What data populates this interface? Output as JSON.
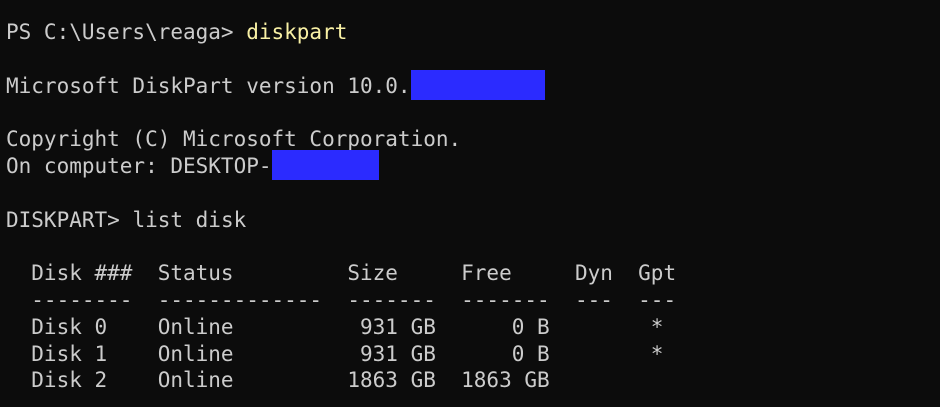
{
  "terminal": {
    "prompt": "PS C:\\Users\\reaga> ",
    "command": "diskpart",
    "version_line": "Microsoft DiskPart version 10.0.",
    "copyright_line": "Copyright (C) Microsoft Corporation.",
    "computer_line": "On computer: DESKTOP-",
    "diskpart_prompt": "DISKPART> ",
    "diskpart_command": "list disk"
  },
  "redaction_color": "#2b2bff",
  "table": {
    "header": "  Disk ###  Status         Size     Free     Dyn  Gpt",
    "separator": "  --------  -------------  -------  -------  ---  ---",
    "rows": [
      "  Disk 0    Online          931 GB      0 B        *",
      "  Disk 1    Online          931 GB      0 B        *",
      "  Disk 2    Online         1863 GB  1863 GB"
    ]
  }
}
